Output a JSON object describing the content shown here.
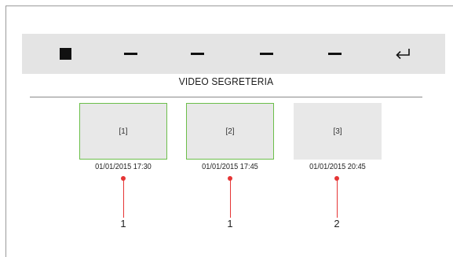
{
  "toolbar": {
    "buttons": [
      {
        "icon": "stop-square-icon"
      },
      {
        "icon": "dash-icon"
      },
      {
        "icon": "dash-icon"
      },
      {
        "icon": "dash-icon"
      },
      {
        "icon": "dash-icon"
      },
      {
        "icon": "return-arrow-icon",
        "glyph": "↵"
      }
    ]
  },
  "screen": {
    "title": "VIDEO SEGRETERIA"
  },
  "messages": [
    {
      "label": "[1]",
      "timestamp": "01/01/2015 17:30",
      "status": "seen",
      "callout": "1"
    },
    {
      "label": "[2]",
      "timestamp": "01/01/2015 17:45",
      "status": "seen",
      "callout": "1"
    },
    {
      "label": "[3]",
      "timestamp": "01/01/2015 20:45",
      "status": "new",
      "callout": "2"
    }
  ],
  "colors": {
    "toolbar_bg": "#e4e4e4",
    "seen_border": "#6cbf4a",
    "callout_line": "#e53535"
  }
}
